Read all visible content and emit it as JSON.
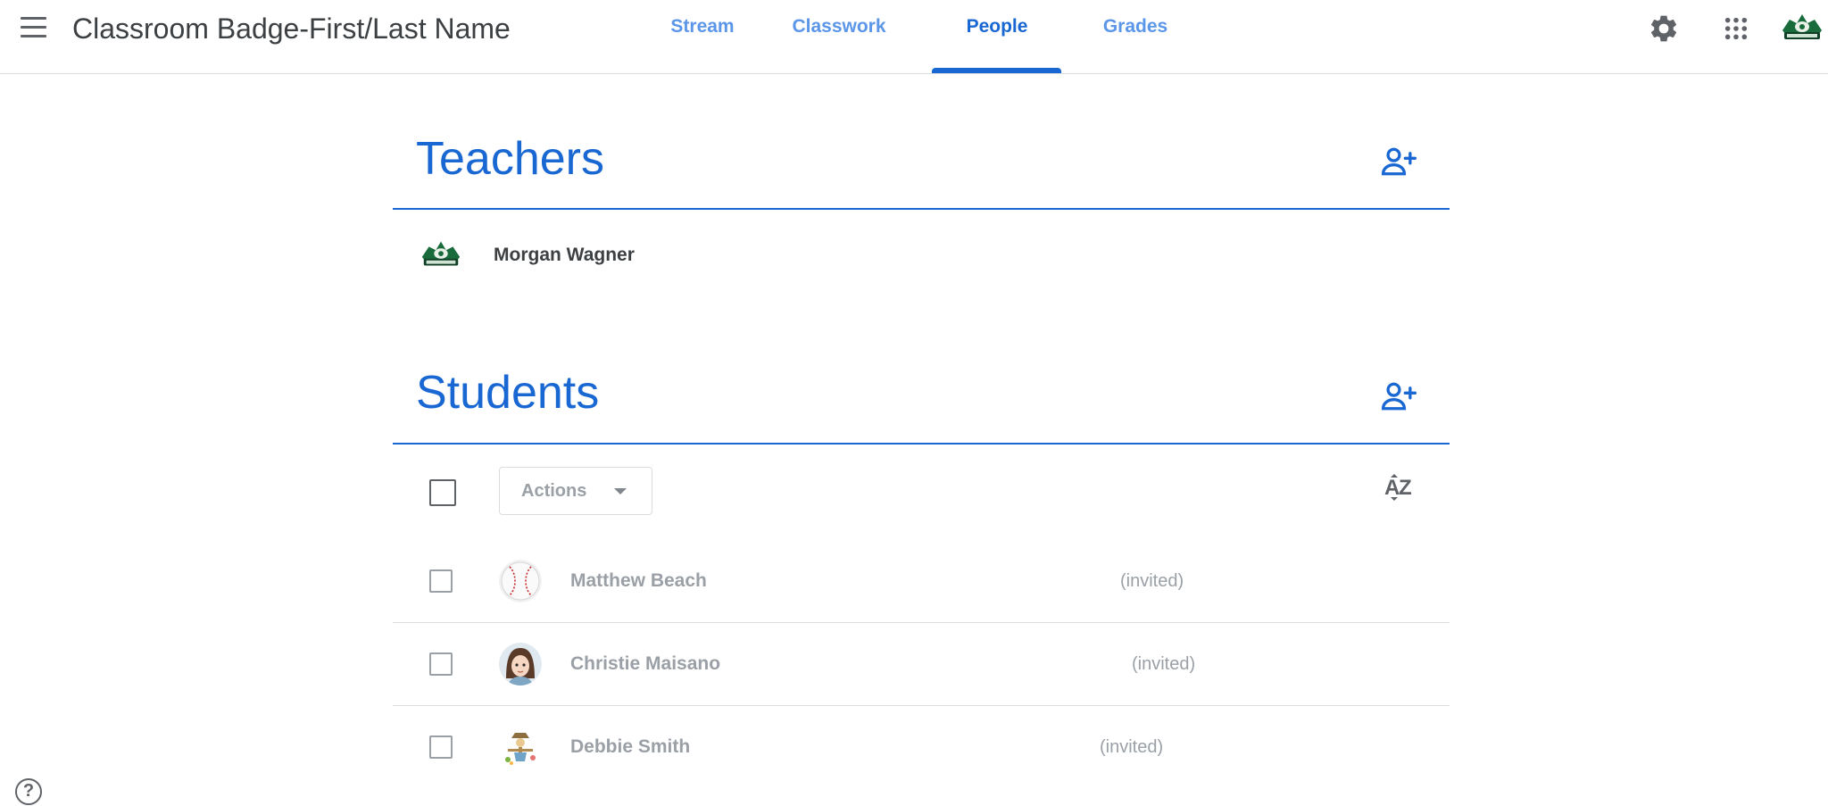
{
  "header": {
    "menu_icon": "hamburger-menu-icon",
    "class_title": "Classroom Badge-First/Last Name",
    "tabs": [
      {
        "label": "Stream",
        "active": false
      },
      {
        "label": "Classwork",
        "active": false
      },
      {
        "label": "People",
        "active": true
      },
      {
        "label": "Grades",
        "active": false
      }
    ],
    "right_icons": [
      "gear-icon",
      "apps-grid-icon",
      "account-avatar"
    ]
  },
  "teachers": {
    "title": "Teachers",
    "invite_icon": "person-add-icon",
    "list": [
      {
        "name": "Morgan Wagner",
        "avatar": "team-logo-avatar"
      }
    ]
  },
  "students": {
    "title": "Students",
    "invite_icon": "person-add-icon",
    "actions_label": "Actions",
    "sort_icon": "sort-az-icon",
    "list": [
      {
        "name": "Matthew Beach",
        "status": "(invited)",
        "avatar": "baseball-avatar"
      },
      {
        "name": "Christie Maisano",
        "status": "(invited)",
        "avatar": "cartoon-girl-avatar"
      },
      {
        "name": "Debbie Smith",
        "status": "(invited)",
        "avatar": "scarecrow-avatar"
      }
    ]
  },
  "help": {
    "label": "?"
  },
  "colors": {
    "accent": "#1967d2",
    "tab_inactive": "#5b96e8",
    "muted_text": "#9aa0a6",
    "divider": "#dadce0",
    "logo_green": "#1a6b3c"
  }
}
